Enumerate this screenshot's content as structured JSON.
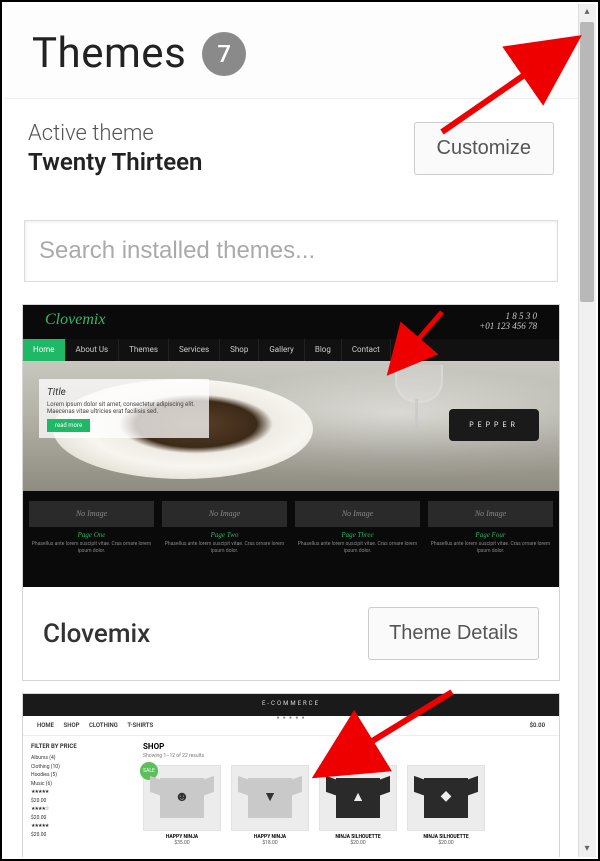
{
  "header": {
    "title": "Themes",
    "count": "7"
  },
  "active": {
    "label": "Active theme",
    "name": "Twenty Thirteen",
    "customize_btn": "Customize"
  },
  "search": {
    "placeholder": "Search installed themes..."
  },
  "theme1": {
    "name": "Clovemix",
    "details_btn": "Theme Details",
    "preview": {
      "logo": "Clovemix",
      "nav": [
        "Home",
        "About Us",
        "Themes",
        "Services",
        "Shop",
        "Gallery",
        "Blog",
        "Contact"
      ],
      "pepper": "PEPPER",
      "tile_img_text": "No Image"
    }
  },
  "theme2": {
    "preview": {
      "brand": "E-COMMERCE",
      "nav_left": [
        "HOME",
        "SHOP",
        "CLOTHING",
        "T-SHIRTS"
      ],
      "cart": "$0.00",
      "shop_heading": "SHOP",
      "side_price_heading": "FILTER BY PRICE",
      "products": [
        {
          "name": "HAPPY NINJA",
          "price": "$35.00"
        },
        {
          "name": "HAPPY NINJA",
          "price": "$18.00"
        },
        {
          "name": "NINJA SILHOUETTE",
          "price": "$20.00"
        },
        {
          "name": "NINJA SILHOUETTE",
          "price": "$20.00"
        }
      ]
    }
  }
}
